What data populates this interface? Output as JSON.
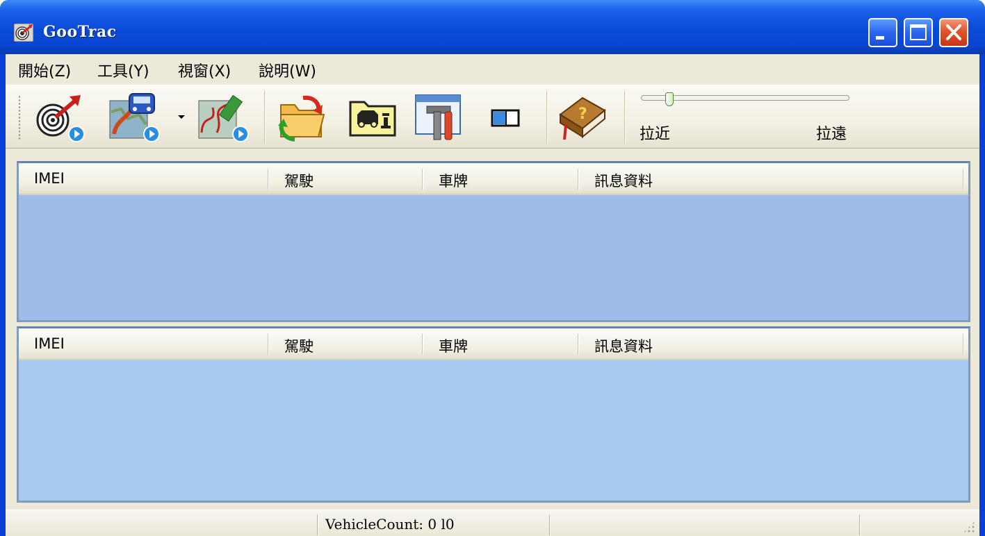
{
  "window": {
    "title": "GooTrac"
  },
  "menu": {
    "items": [
      {
        "label": "開始(Z)"
      },
      {
        "label": "工具(Y)"
      },
      {
        "label": "視窗(X)"
      },
      {
        "label": "說明(W)"
      }
    ]
  },
  "toolbar": {
    "buttons": [
      {
        "icon": "target-tracking-icon"
      },
      {
        "icon": "vehicle-route-icon"
      },
      {
        "icon": "route-edit-icon"
      },
      {
        "icon": "folder-refresh-icon"
      },
      {
        "icon": "vehicle-folder-icon"
      },
      {
        "icon": "settings-tools-icon"
      },
      {
        "icon": "split-view-icon"
      },
      {
        "icon": "help-book-icon"
      }
    ],
    "zoom": {
      "near_label": "拉近",
      "far_label": "拉遠",
      "level": 0.12
    }
  },
  "top_pane": {
    "columns": [
      "IMEI",
      "駕駛",
      "車牌",
      "訊息資料"
    ],
    "rows": [],
    "body_color": "#9ebbea"
  },
  "bottom_pane": {
    "columns": [
      "IMEI",
      "駕駛",
      "車牌",
      "訊息資料"
    ],
    "rows": [],
    "body_color": "#a6caf0"
  },
  "status": {
    "vehicle_count": "VehicleCount: 0 l0"
  },
  "colors": {
    "titlebar": "#0a4ad8",
    "close_button": "#e0532c",
    "client_bg": "#ece9d8"
  }
}
